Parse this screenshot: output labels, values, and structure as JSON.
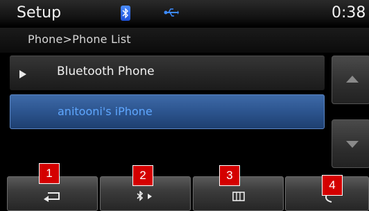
{
  "status_bar": {
    "title": "Setup",
    "clock": "0:38",
    "icons": [
      "bluetooth-icon",
      "usb-icon"
    ]
  },
  "breadcrumb": "Phone>Phone List",
  "list": {
    "items": [
      {
        "label": "Bluetooth Phone",
        "icon": "play-arrow-icon"
      },
      {
        "label": "anitooni's iPhone",
        "selected": true
      }
    ]
  },
  "scroll": {
    "up_icon": "triangle-up-icon",
    "down_icon": "triangle-down-icon"
  },
  "softkeys": [
    {
      "icon": "back-icon",
      "marker": "1"
    },
    {
      "icon": "bluetooth-forward-icon",
      "marker": "2"
    },
    {
      "icon": "phonebook-icon",
      "marker": "3"
    },
    {
      "icon": "call-icon",
      "marker": "4"
    }
  ],
  "colors": {
    "selected_row": "#2c548e",
    "selected_text": "#5fa7ff",
    "marker": "#d40000"
  }
}
